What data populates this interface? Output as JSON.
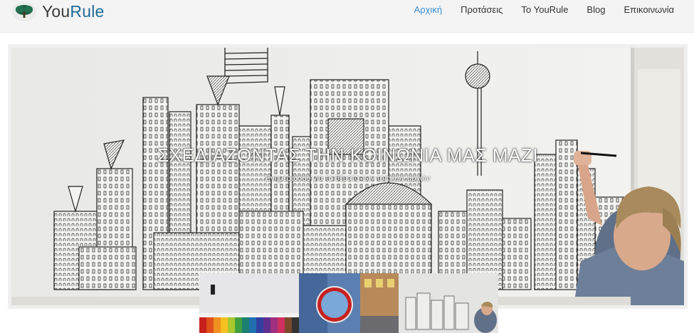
{
  "brand": {
    "part1": "You",
    "part2": "Rule"
  },
  "nav": {
    "items": [
      {
        "label": "Αρχική",
        "active": true
      },
      {
        "label": "Προτάσεις",
        "active": false
      },
      {
        "label": "Το YouRule",
        "active": false
      },
      {
        "label": "Blog",
        "active": false
      },
      {
        "label": "Επικοινωνία",
        "active": false
      }
    ]
  },
  "hero": {
    "title": "ΣΧΕΔΙΑΖΟΝΤΑΣ ΤΗΝ ΚΟΙΝΩΝΙΑ ΜΑΣ ΜΑΖΙ",
    "subtitle": "Ενημερώσου για τα θέματα των τοπικών αρχών"
  },
  "colors": {
    "accent": "#3b8fd0",
    "brand_blue": "#1f6b9a",
    "navbar_bg": "#f4f4f4"
  },
  "thumbnails": [
    {
      "name": "color-pencils-thumbnail"
    },
    {
      "name": "road-sign-thumbnail"
    },
    {
      "name": "mural-drawing-thumbnail"
    }
  ]
}
